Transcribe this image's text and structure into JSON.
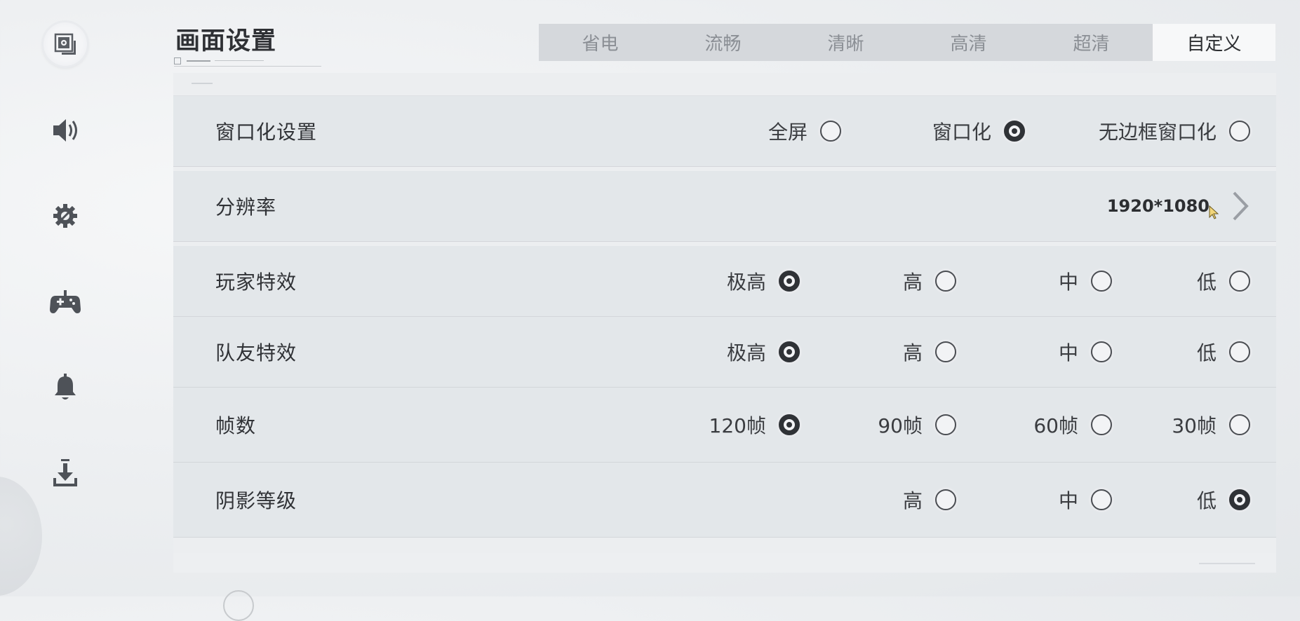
{
  "header": {
    "title": "画面设置"
  },
  "sidebar": {
    "items": [
      {
        "icon": "display-settings-icon",
        "active": true
      },
      {
        "icon": "speaker-icon",
        "active": false
      },
      {
        "icon": "gear-icon",
        "active": false
      },
      {
        "icon": "gamepad-icon",
        "active": false
      },
      {
        "icon": "bell-icon",
        "active": false
      },
      {
        "icon": "download-icon",
        "active": false
      }
    ]
  },
  "presets": {
    "tabs": [
      "省电",
      "流畅",
      "清晰",
      "高清",
      "超清",
      "自定义"
    ],
    "selected": "自定义"
  },
  "settings": {
    "window_mode": {
      "label": "窗口化设置",
      "options": [
        "全屏",
        "窗口化",
        "无边框窗口化"
      ],
      "selected": "窗口化"
    },
    "resolution": {
      "label": "分辨率",
      "value": "1920*1080"
    },
    "player_effects": {
      "label": "玩家特效",
      "options": [
        "极高",
        "高",
        "中",
        "低"
      ],
      "selected": "极高"
    },
    "teammate_effects": {
      "label": "队友特效",
      "options": [
        "极高",
        "高",
        "中",
        "低"
      ],
      "selected": "极高"
    },
    "frame_rate": {
      "label": "帧数",
      "options": [
        "120帧",
        "90帧",
        "60帧",
        "30帧"
      ],
      "selected": "120帧"
    },
    "shadow_level": {
      "label": "阴影等级",
      "options": [
        "高",
        "中",
        "低"
      ],
      "selected": "低"
    }
  },
  "colors": {
    "accent_dark": "#2f3236",
    "tab_bar": "#d5d8dc",
    "tab_active": "#f7f8f9",
    "row_bg": "#e3e7ea"
  }
}
